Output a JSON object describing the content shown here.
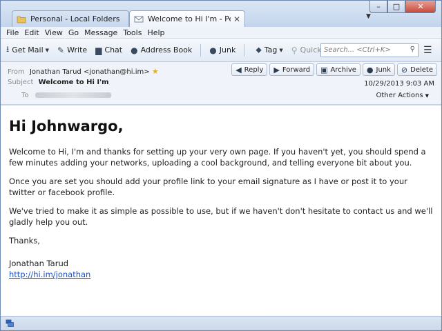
{
  "tabs": [
    {
      "label": "Personal - Local Folders",
      "icon": "folder-icon"
    },
    {
      "label": "Welcome to Hi I'm - Pers…",
      "icon": "envelope-icon"
    }
  ],
  "window_controls": {
    "minimize": "–",
    "maximize": "□",
    "close": "✕"
  },
  "menu": [
    "File",
    "Edit",
    "View",
    "Go",
    "Message",
    "Tools",
    "Help"
  ],
  "toolbar": {
    "get_mail": "Get Mail",
    "write": "Write",
    "chat": "Chat",
    "address_book": "Address Book",
    "junk": "Junk",
    "tag": "Tag",
    "quick_filter": "Quick Filter",
    "search_placeholder": "Search... <Ctrl+K>"
  },
  "header": {
    "from_label": "From",
    "from_value": "Jonathan Tarud <jonathan@hi.im>",
    "subject_label": "Subject",
    "subject_value": "Welcome to Hi I'm",
    "to_label": "To",
    "date": "10/29/2013 9:03 AM",
    "other_actions": "Other Actions",
    "buttons": {
      "reply": "Reply",
      "forward": "Forward",
      "archive": "Archive",
      "junk": "Junk",
      "delete": "Delete"
    }
  },
  "message": {
    "heading": "Hi Johnwargo,",
    "p1": "Welcome to Hi, I'm and thanks for setting up your very own page. If you haven't yet, you should spend a few minutes adding your networks, uploading a cool background, and telling everyone bit about you.",
    "p2": "Once you are set you should add your profile link to your email signature as I have or post it to your twitter or facebook profile.",
    "p3": "We've tried to make it as simple as possible to use, but if we haven't don't hesitate to contact us and we'll gladly help you out.",
    "thanks": "Thanks,",
    "signature_name": "Jonathan Tarud",
    "signature_link": "http://hi.im/jonathan"
  },
  "colors": {
    "link": "#1a52c8",
    "accent": "#c9d9ee"
  }
}
